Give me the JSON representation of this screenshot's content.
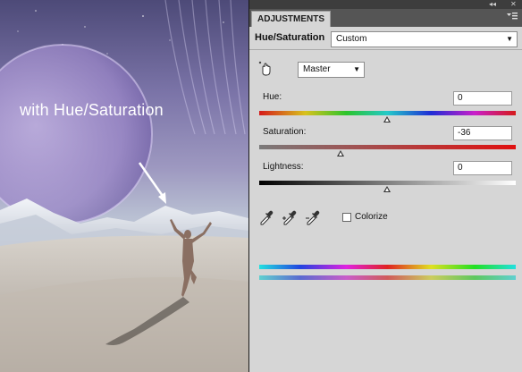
{
  "artwork": {
    "caption": "with Hue/Saturation",
    "arrow_color": "#ffffff"
  },
  "panel": {
    "tab_label": "ADJUSTMENTS",
    "window_controls": [
      "◂◂",
      "✕"
    ],
    "tab_menu_icon": "panel-menu-icon",
    "title": "Hue/Saturation",
    "preset": {
      "value": "Custom"
    },
    "channel": {
      "value": "Master"
    },
    "hue": {
      "label": "Hue:",
      "value": "0",
      "position_fraction": 0.5
    },
    "saturation": {
      "label": "Saturation:",
      "value": "-36",
      "position_fraction": 0.32
    },
    "lightness": {
      "label": "Lightness:",
      "value": "0",
      "position_fraction": 0.5
    },
    "colorize": {
      "label": "Colorize",
      "checked": false
    },
    "eyedroppers": [
      "eyedropper-icon",
      "eyedropper-plus-icon",
      "eyedropper-minus-icon"
    ]
  },
  "colors": {
    "panel_bg": "#d6d6d6",
    "saturation_bar_start": "#7a7a7a",
    "saturation_bar_end": "#e01010"
  }
}
